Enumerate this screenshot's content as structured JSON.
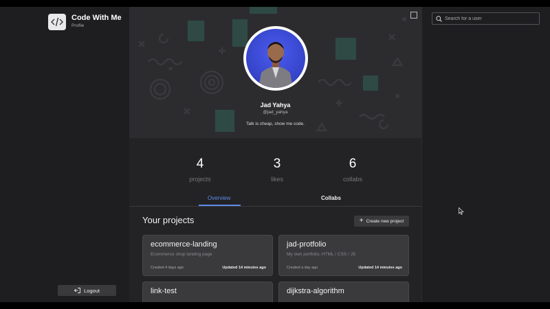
{
  "app": {
    "title": "Code With Me",
    "subtitle": "Profile"
  },
  "sidebar": {
    "logout_label": "Logout"
  },
  "profile": {
    "name": "Jad Yahya",
    "handle": "@jad_yahya",
    "bio": "Talk is cheap, show me code."
  },
  "stats": [
    {
      "value": "4",
      "label": "projects"
    },
    {
      "value": "3",
      "label": "likes"
    },
    {
      "value": "6",
      "label": "collabs"
    }
  ],
  "tabs": [
    {
      "label": "Overview",
      "active": true
    },
    {
      "label": "Collabs",
      "active": false
    }
  ],
  "projects_section": {
    "title": "Your projects",
    "create_label": "Create new project"
  },
  "projects": [
    {
      "title": "ecommerce-landing",
      "description": "Ecommerce shop landing page",
      "created": "Created 4 days ago",
      "updated": "Updated 14 minutes ago"
    },
    {
      "title": "jad-protfolio",
      "description": "My own portfolio, HTML / CSS / JS",
      "created": "Created a day ago",
      "updated": "Updated 14 minutes ago"
    },
    {
      "title": "link-test",
      "description": "",
      "created": "",
      "updated": ""
    },
    {
      "title": "dijkstra-algorithm",
      "description": "",
      "created": "",
      "updated": ""
    }
  ],
  "search": {
    "placeholder": "Search for a user",
    "value": ""
  },
  "colors": {
    "accent": "#5d8ae6",
    "background": "#232325",
    "card": "#3a3a3d",
    "avatar_bg": "#3f4fe0"
  },
  "icons": [
    "code-logo-icon",
    "logout-icon",
    "expand-icon",
    "plus-icon",
    "search-icon",
    "cursor-icon"
  ]
}
